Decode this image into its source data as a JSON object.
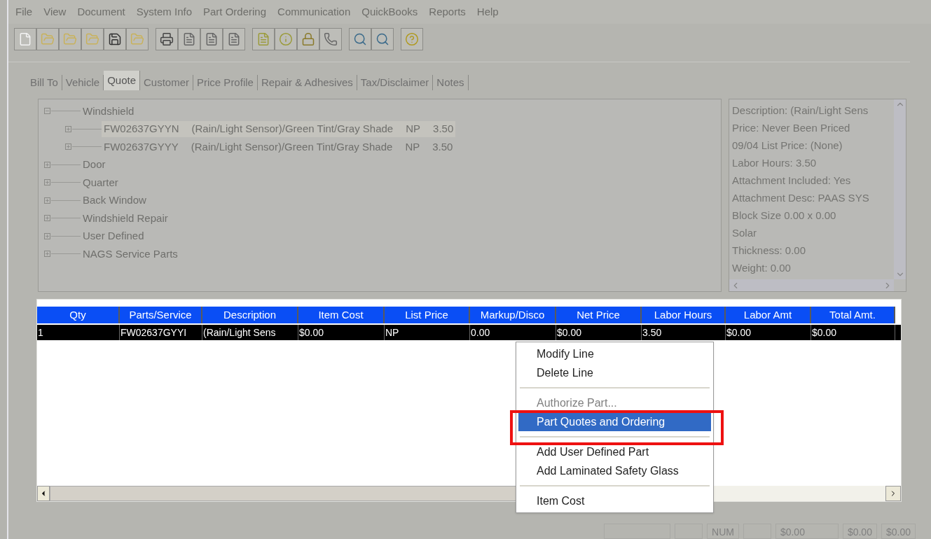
{
  "menu_bar": [
    "File",
    "View",
    "Document",
    "System Info",
    "Part Ordering",
    "Communication",
    "QuickBooks",
    "Reports",
    "Help"
  ],
  "toolbar": [
    {
      "kind": "new"
    },
    {
      "kind": "open"
    },
    {
      "kind": "open"
    },
    {
      "kind": "open"
    },
    {
      "kind": "save"
    },
    {
      "kind": "open"
    },
    {
      "kind": "gap"
    },
    {
      "kind": "print"
    },
    {
      "kind": "doc"
    },
    {
      "kind": "doc"
    },
    {
      "kind": "doc"
    },
    {
      "kind": "gap"
    },
    {
      "kind": "word"
    },
    {
      "kind": "info"
    },
    {
      "kind": "lock"
    },
    {
      "kind": "phone"
    },
    {
      "kind": "gap"
    },
    {
      "kind": "search"
    },
    {
      "kind": "search"
    },
    {
      "kind": "gap"
    },
    {
      "kind": "help"
    }
  ],
  "tabs": [
    {
      "label": "Bill To",
      "selected": false
    },
    {
      "label": "Vehicle",
      "selected": false
    },
    {
      "label": "Quote",
      "selected": true
    },
    {
      "label": "Customer",
      "selected": false
    },
    {
      "label": "Price Profile",
      "selected": false
    },
    {
      "label": "Repair & Adhesives",
      "selected": false
    },
    {
      "label": "Tax/Disclaimer",
      "selected": false
    },
    {
      "label": "Notes",
      "selected": false
    }
  ],
  "tree": [
    {
      "label": "Windshield",
      "expanded": true,
      "children": [
        {
          "part": "FW02637GYYN",
          "description": "(Rain/Light Sensor)/Green Tint/Gray Shade",
          "price": "NP",
          "hours": "3.50",
          "selected": true
        },
        {
          "part": "FW02637GYYY",
          "description": "(Rain/Light Sensor)/Green Tint/Gray Shade",
          "price": "NP",
          "hours": "3.50",
          "selected": false
        }
      ]
    },
    {
      "label": "Door",
      "expanded": false
    },
    {
      "label": "Quarter",
      "expanded": false
    },
    {
      "label": "Back Window",
      "expanded": false
    },
    {
      "label": "Windshield Repair",
      "expanded": false
    },
    {
      "label": "User Defined",
      "expanded": false
    },
    {
      "label": "NAGS Service Parts",
      "expanded": false
    }
  ],
  "details": [
    "Description: (Rain/Light Sens",
    "Price: Never Been Priced",
    "09/04 List Price: (None)",
    "Labor Hours: 3.50",
    "Attachment Included: Yes",
    "Attachment Desc: PAAS SYS",
    "Block Size  0.00 x 0.00",
    "Solar",
    "Thickness: 0.00",
    "Weight: 0.00"
  ],
  "table": {
    "columns": [
      "Qty",
      "Parts/Service",
      "Description",
      "Item Cost",
      "List Price",
      "Markup/Disco",
      "Net Price",
      "Labor Hours",
      "Labor Amt",
      "Total Amt."
    ],
    "rows": [
      {
        "cells": [
          "1",
          "FW02637GYYI",
          "(Rain/Light Sens",
          "$0.00",
          "NP",
          "0.00",
          "$0.00",
          "3.50",
          "$0.00",
          "$0.00"
        ],
        "selected": true
      }
    ]
  },
  "context_menu": [
    {
      "kind": "item",
      "label": "Modify Line",
      "disabled": false,
      "selected": false
    },
    {
      "kind": "item",
      "label": "Delete Line",
      "disabled": false,
      "selected": false
    },
    {
      "kind": "separator"
    },
    {
      "kind": "item",
      "label": "Authorize Part...",
      "disabled": true,
      "selected": false
    },
    {
      "kind": "item",
      "label": "Part Quotes and Ordering",
      "disabled": false,
      "selected": true
    },
    {
      "kind": "separator"
    },
    {
      "kind": "item",
      "label": "Add User Defined Part",
      "disabled": false,
      "selected": false
    },
    {
      "kind": "item",
      "label": "Add Laminated Safety Glass",
      "disabled": false,
      "selected": false
    },
    {
      "kind": "separator"
    },
    {
      "kind": "item",
      "label": "Item Cost",
      "disabled": false,
      "selected": false
    }
  ],
  "status_bar": [
    {
      "kind": "empty"
    },
    {
      "kind": "empty"
    },
    {
      "kind": "text",
      "text": "NUM"
    },
    {
      "kind": "empty"
    },
    {
      "kind": "text",
      "text": "$0.00"
    },
    {
      "kind": "text",
      "text": "$0.00"
    },
    {
      "kind": "text",
      "text": "$0.00"
    }
  ]
}
